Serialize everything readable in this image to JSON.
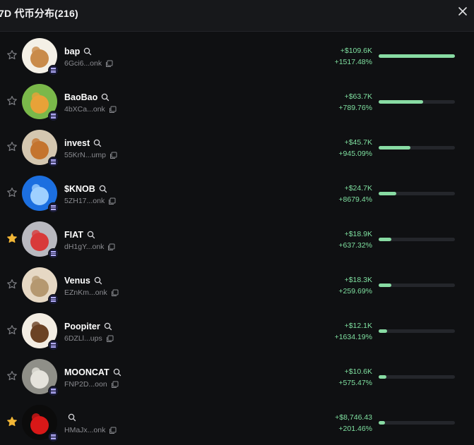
{
  "header": {
    "title": "7D 代币分布(216)"
  },
  "colors": {
    "accent_green": "#88dba3",
    "star_active": "#f2b636",
    "star_inactive": "#7c7d82"
  },
  "tokens": [
    {
      "name": "bap",
      "address": "6Gci6...onk",
      "value": "+$109.6K",
      "pct": "+1517.48%",
      "share": 1.0,
      "starred": false,
      "bg": "#f4f0e6",
      "fg": "#c98b4a"
    },
    {
      "name": "BaoBao",
      "address": "4bXCa...onk",
      "value": "+$63.7K",
      "pct": "+789.76%",
      "share": 0.58,
      "starred": false,
      "bg": "#7ab84a",
      "fg": "#e8a238"
    },
    {
      "name": "invest",
      "address": "55KrN...ump",
      "value": "+$45.7K",
      "pct": "+945.09%",
      "share": 0.42,
      "starred": false,
      "bg": "#d4c7b0",
      "fg": "#c4742e"
    },
    {
      "name": "$KNOB",
      "address": "5ZH17...onk",
      "value": "+$24.7K",
      "pct": "+8679.4%",
      "share": 0.23,
      "starred": false,
      "bg": "#1c6fe0",
      "fg": "#9fd0ff"
    },
    {
      "name": "FIAT",
      "address": "dH1gY...onk",
      "value": "+$18.9K",
      "pct": "+637.32%",
      "share": 0.17,
      "starred": true,
      "bg": "#b9b9c0",
      "fg": "#d83a3a"
    },
    {
      "name": "Venus",
      "address": "EZnKm...onk",
      "value": "+$18.3K",
      "pct": "+259.69%",
      "share": 0.17,
      "starred": false,
      "bg": "#e6d8c4",
      "fg": "#b59870"
    },
    {
      "name": "Poopiter",
      "address": "6DZLl...ups",
      "value": "+$12.1K",
      "pct": "+1634.19%",
      "share": 0.11,
      "starred": false,
      "bg": "#f3ede3",
      "fg": "#6b4224"
    },
    {
      "name": "MOONCAT",
      "address": "FNP2D...oon",
      "value": "+$10.6K",
      "pct": "+575.47%",
      "share": 0.1,
      "starred": false,
      "bg": "#8f8f88",
      "fg": "#e5e3dc"
    },
    {
      "name": "",
      "address": "HMaJx...onk",
      "value": "+$8,746.43",
      "pct": "+201.46%",
      "share": 0.08,
      "starred": true,
      "bg": "#0b0b0b",
      "fg": "#d81818"
    }
  ]
}
